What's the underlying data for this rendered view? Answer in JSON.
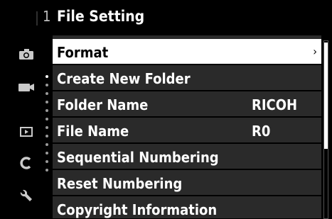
{
  "header": {
    "tab_number": "1",
    "title": "File Setting"
  },
  "sidebar": {
    "icons": [
      "camera-icon",
      "video-icon",
      "playback-icon",
      "custom-icon",
      "wrench-icon"
    ]
  },
  "menu": {
    "items": [
      {
        "label": "Format",
        "value": "",
        "selected": true,
        "chevron": "›"
      },
      {
        "label": "Create New Folder",
        "value": ""
      },
      {
        "label": "Folder Name",
        "value": "RICOH"
      },
      {
        "label": "File Name",
        "value": "R0"
      },
      {
        "label": "Sequential Numbering",
        "value": ""
      },
      {
        "label": "Reset Numbering",
        "value": ""
      },
      {
        "label": "Copyright Information",
        "value": ""
      }
    ]
  }
}
